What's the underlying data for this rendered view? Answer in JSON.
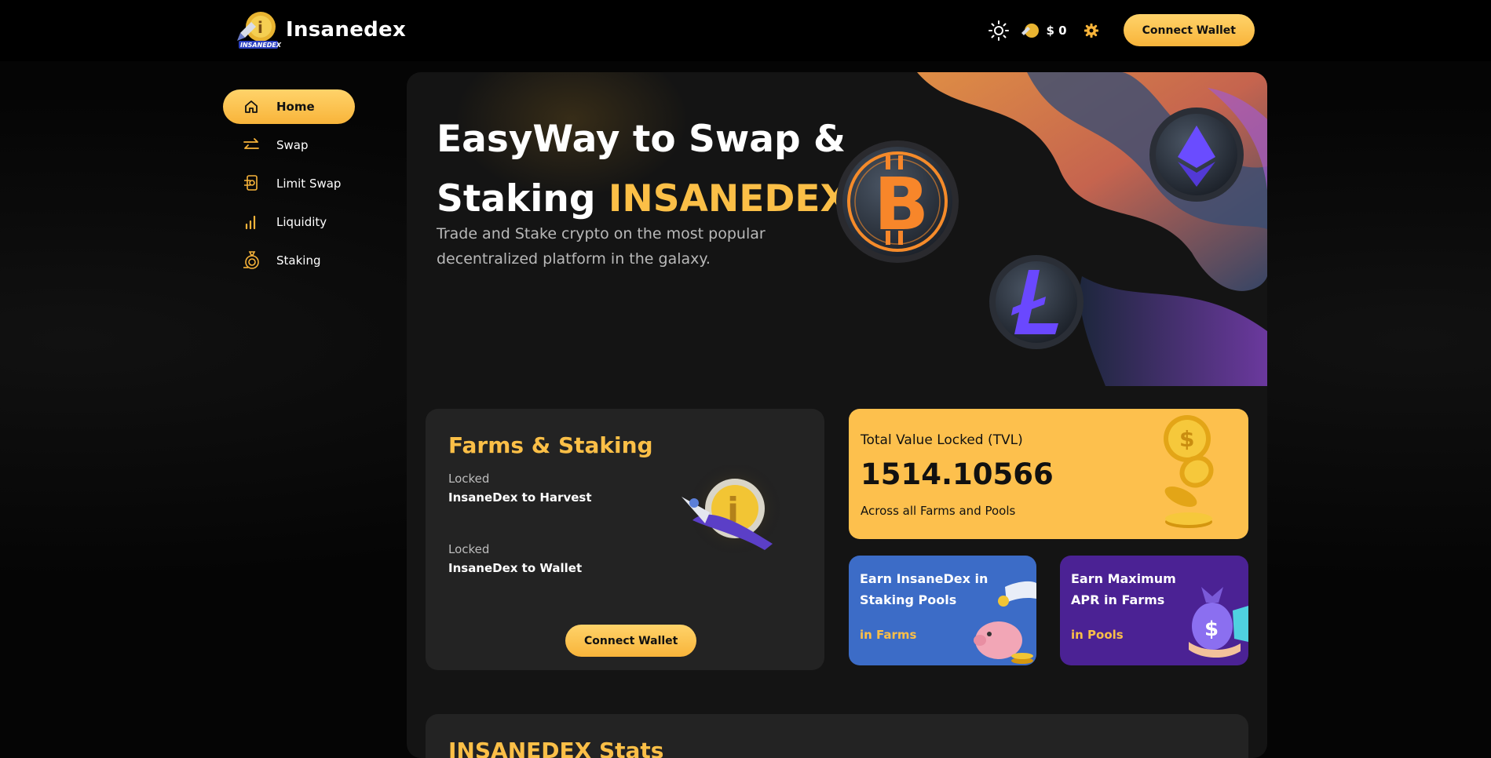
{
  "app": {
    "name": "Insanedex",
    "logo_caption": "INSANEDEX"
  },
  "header": {
    "price": "$ 0",
    "connect_label": "Connect Wallet"
  },
  "sidebar": {
    "items": [
      {
        "label": "Home",
        "icon": "home-icon",
        "active": true
      },
      {
        "label": "Swap",
        "icon": "swap-arrows-icon",
        "active": false
      },
      {
        "label": "Limit Swap",
        "icon": "limit-swap-icon",
        "active": false
      },
      {
        "label": "Liquidity",
        "icon": "bar-chart-icon",
        "active": false
      },
      {
        "label": "Staking",
        "icon": "staking-coin-icon",
        "active": false
      }
    ]
  },
  "hero": {
    "title_line1": "EasyWay to Swap &",
    "title_line2_prefix": "Staking ",
    "title_line2_accent": "INSANEDEX",
    "subtitle": "Trade and Stake crypto on the most popular decentralized platform in the galaxy."
  },
  "farms": {
    "title": "Farms & Staking",
    "harvest_label": "Locked",
    "harvest_value": "InsaneDex to Harvest",
    "wallet_label": "Locked",
    "wallet_value": "InsaneDex to Wallet",
    "connect_label": "Connect Wallet"
  },
  "tvl": {
    "label": "Total Value Locked (TVL)",
    "value": "1514.10566",
    "desc": "Across all Farms and Pools"
  },
  "cards": {
    "staking": {
      "title": "Earn InsaneDex in Staking Pools",
      "link": "in Farms"
    },
    "farms": {
      "title": "Earn Maximum APR in Farms",
      "link": "in Pools"
    }
  },
  "stats": {
    "title": "INSANEDEX Stats"
  },
  "colors": {
    "accent": "#fbbf47",
    "background": "#000000",
    "panel": "#141414",
    "card": "#232323",
    "blue_card": "#3c6cc7",
    "purple_card": "#4b2294"
  }
}
